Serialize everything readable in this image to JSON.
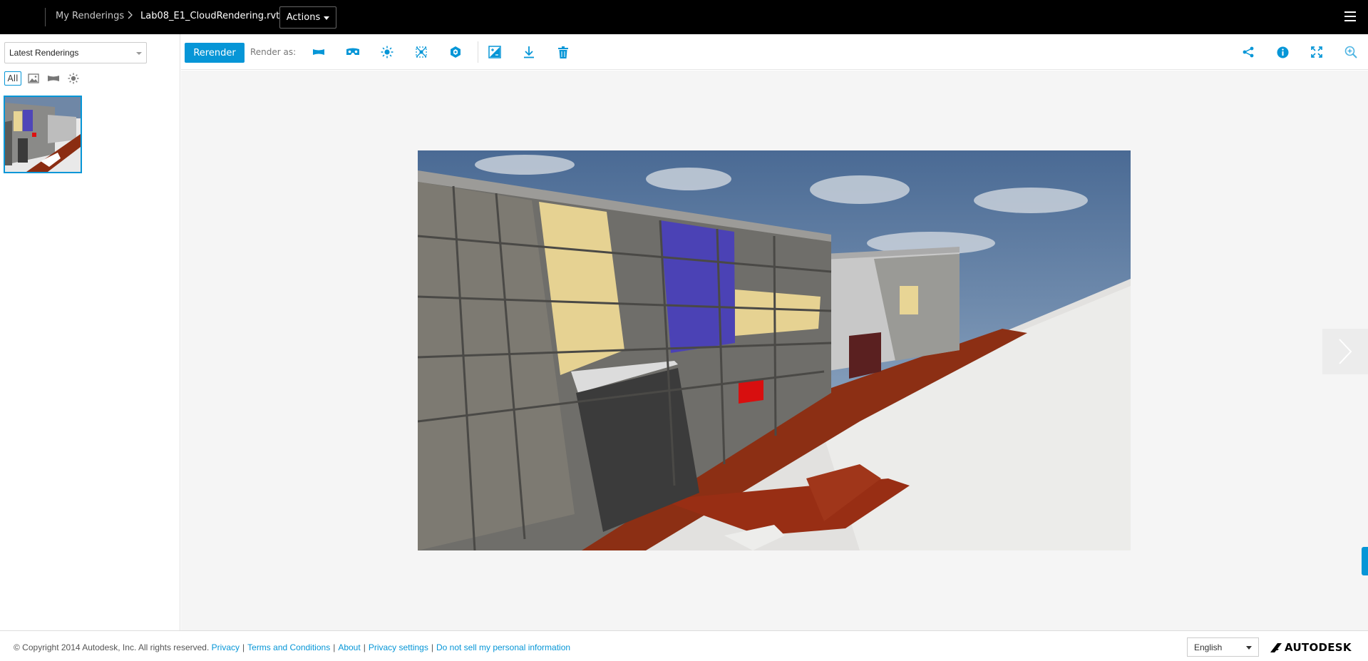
{
  "header": {
    "breadcrumb_root": "My Renderings",
    "breadcrumb_file": "Lab08_E1_CloudRendering.rvt",
    "actions_label": "Actions"
  },
  "sidebar": {
    "filter_value": "Latest Renderings",
    "type_filters": [
      {
        "label": "All",
        "icon": "all"
      },
      {
        "label": "",
        "icon": "image-icon"
      },
      {
        "label": "",
        "icon": "panorama-icon"
      },
      {
        "label": "",
        "icon": "sun-icon"
      }
    ]
  },
  "toolbar": {
    "rerender_label": "Rerender",
    "render_as_label": "Render as:",
    "icons": [
      "panorama-icon",
      "stereo-panorama-icon",
      "illuminance-icon",
      "solar-study-icon",
      "exposure-icon",
      "adjust-exposure-icon",
      "download-icon",
      "delete-icon"
    ],
    "right_icons": [
      "share-icon",
      "info-icon",
      "fullscreen-icon",
      "zoom-icon"
    ]
  },
  "colors": {
    "accent": "#0696d7",
    "topbar": "#000000",
    "viewer_bg": "#f5f5f5"
  },
  "footer": {
    "copyright": "© Copyright 2014 Autodesk, Inc. All rights reserved.",
    "links": [
      "Privacy",
      "Terms and Conditions",
      "About",
      "Privacy settings",
      "Do not sell my personal information"
    ],
    "language": "English",
    "brand": "AUTODESK"
  }
}
